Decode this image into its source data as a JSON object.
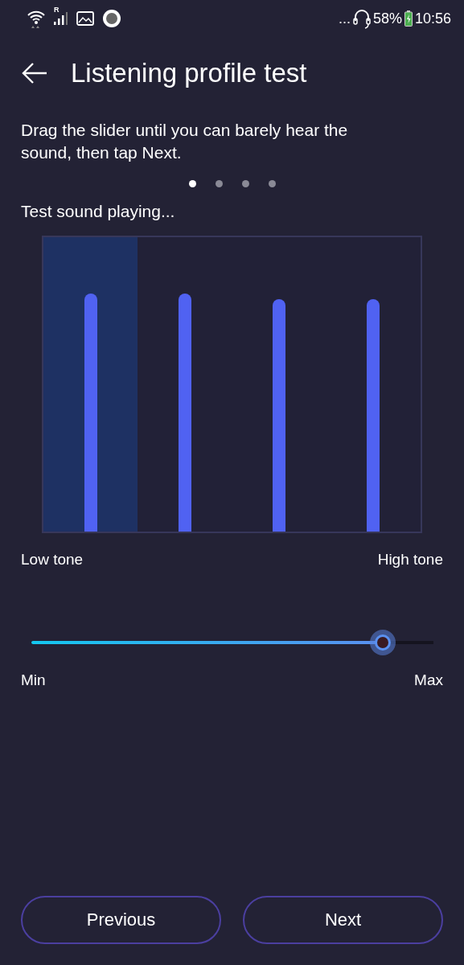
{
  "status_bar": {
    "signal_label": "R",
    "overflow": "...",
    "battery": "58%",
    "time": "10:56"
  },
  "header": {
    "title": "Listening profile test"
  },
  "instruction": "Drag the slider until you can barely hear the sound, then tap Next.",
  "pages": [
    {
      "selected": true
    },
    {
      "selected": false
    },
    {
      "selected": false
    },
    {
      "selected": false
    }
  ],
  "status_text": "Test sound playing...",
  "bands": [
    {
      "selected": true,
      "level": 0.81
    },
    {
      "selected": false,
      "level": 0.81
    },
    {
      "selected": false,
      "level": 0.79
    },
    {
      "selected": false,
      "level": 0.79
    }
  ],
  "band_labels": {
    "low": "Low tone",
    "high": "High tone"
  },
  "volume": {
    "level": 0.874,
    "min_label": "Min",
    "max_label": "Max"
  },
  "buttons": [
    {
      "label": "Previous"
    },
    {
      "label": "Next"
    }
  ]
}
